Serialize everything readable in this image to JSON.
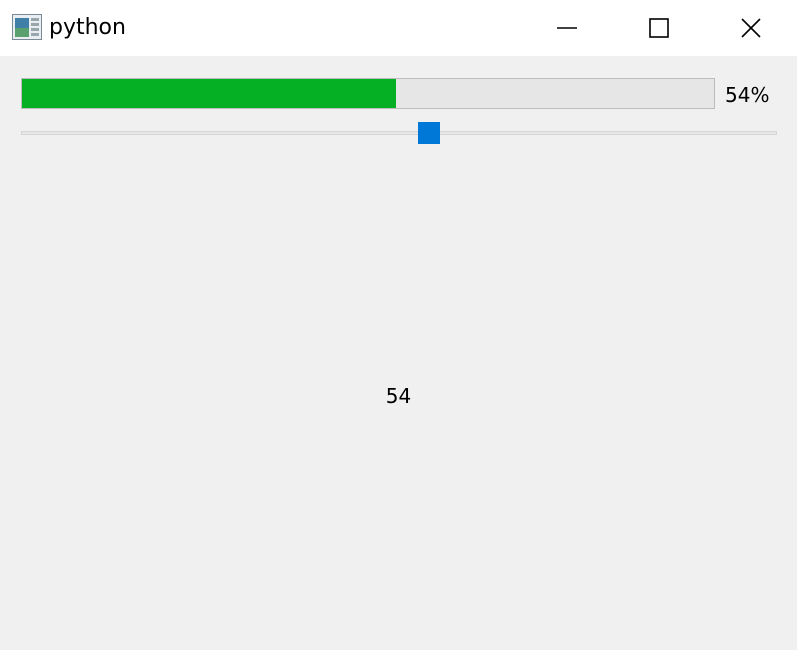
{
  "window": {
    "title": "python",
    "app_icon": "python-app-icon",
    "controls": {
      "minimize_icon": "minimize-icon",
      "maximize_icon": "maximize-icon",
      "close_icon": "close-icon"
    }
  },
  "progress": {
    "value": 54,
    "fraction": 0.54,
    "text": "54%",
    "fill_color": "#06b025"
  },
  "slider": {
    "value": 54,
    "min": 0,
    "max": 100,
    "thumb_color": "#0078d7"
  },
  "value_label": {
    "text": "54"
  }
}
